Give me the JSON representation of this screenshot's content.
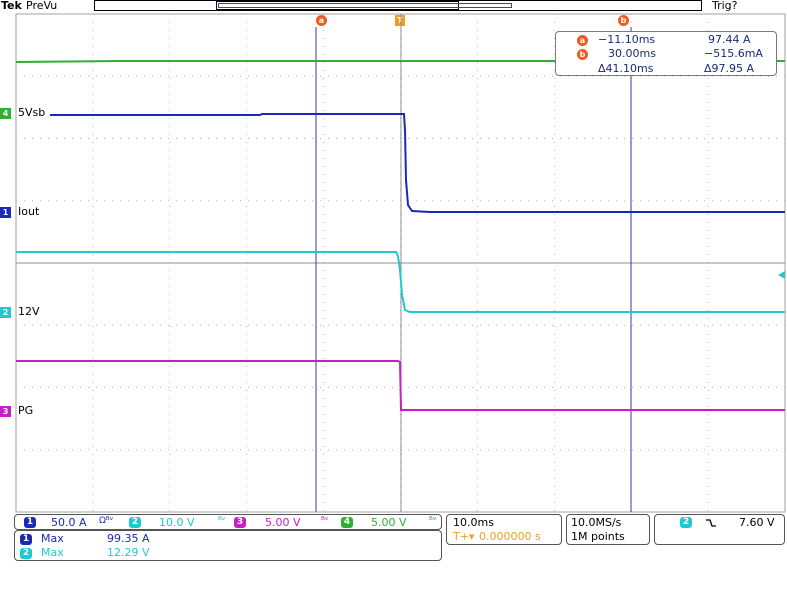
{
  "header": {
    "brand": "Tek",
    "mode": "PreVu",
    "trigger_status": "Trig?"
  },
  "markers": {
    "cursor_a": "a",
    "cursor_b": "b",
    "trigger": "T"
  },
  "channels": [
    {
      "id": "4",
      "label": "5Vsb",
      "color": "#30b030"
    },
    {
      "id": "1",
      "label": "Iout",
      "color": "#1a2ab8"
    },
    {
      "id": "2",
      "label": "12V",
      "color": "#20c8d0"
    },
    {
      "id": "3",
      "label": "PG",
      "color": "#c81ec8"
    }
  ],
  "cursor_readout": {
    "a_time": "−11.10ms",
    "a_value": "97.44 A",
    "b_time": "30.00ms",
    "b_value": "−515.6mA",
    "delta_time": "Δ41.10ms",
    "delta_value": "Δ97.95 A"
  },
  "scales": [
    {
      "ch": "1",
      "value": "50.0 A",
      "suffix": "Ωᴮᵛ",
      "color": "#1a2ab8"
    },
    {
      "ch": "2",
      "value": "10.0 V",
      "suffix": "ᴮᵛ",
      "color": "#20c8d0"
    },
    {
      "ch": "3",
      "value": "5.00 V",
      "suffix": "ᴮᵛ",
      "color": "#c81ec8"
    },
    {
      "ch": "4",
      "value": "5.00 V",
      "suffix": "ᴮᵛ",
      "color": "#30b030"
    }
  ],
  "measurements": [
    {
      "ch": "1",
      "name": "Max",
      "value": "99.35 A",
      "color": "#1a2ab8"
    },
    {
      "ch": "2",
      "name": "Max",
      "value": "12.29 V",
      "color": "#20c8d0"
    }
  ],
  "timebase": {
    "time_div": "10.0ms",
    "trigger_pos": "0.000000 s",
    "sample_rate": "10.0MS/s",
    "record_length": "1M points"
  },
  "trigger": {
    "source": "2",
    "slope_icon": "falling-edge-icon",
    "level": "7.60 V"
  },
  "colors": {
    "grid": "#a0a0a0",
    "cursor_line": "#3a3aa8",
    "marker": "#f05a1e",
    "trigger_marker": "#f0a020"
  }
}
